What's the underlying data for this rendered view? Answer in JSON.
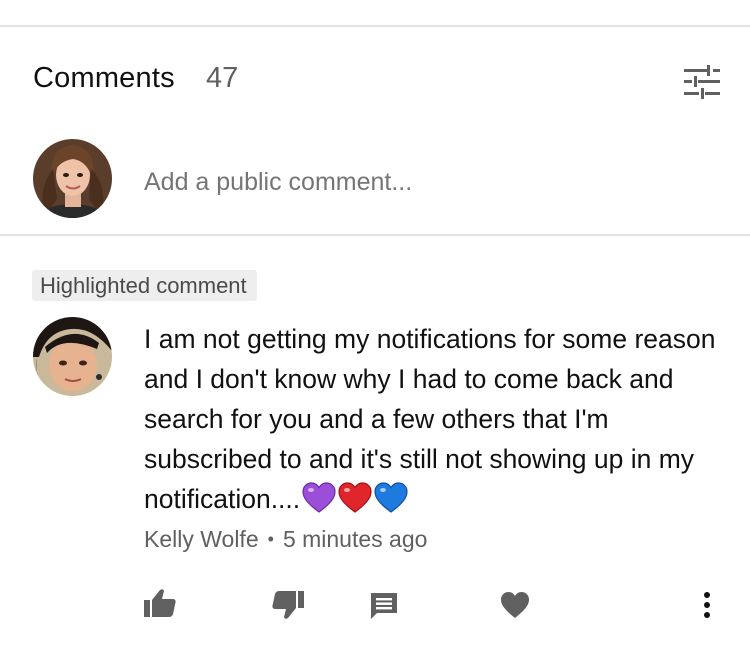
{
  "header": {
    "title": "Comments",
    "count": "47",
    "sort_icon": "sort-filter-icon"
  },
  "composer": {
    "avatar_icon": "user-avatar",
    "placeholder": "Add a public comment..."
  },
  "comment": {
    "badge": "Highlighted comment",
    "avatar_icon": "commenter-avatar",
    "text": "I am not getting my notifications for some reason and I don't know why I had to come back and search for you and a few others that I'm subscribed to and it's still not showing up in my notification....",
    "emoji": [
      "purple-heart",
      "red-heart",
      "blue-heart"
    ],
    "author": "Kelly Wolfe",
    "separator": "•",
    "time": "5 minutes ago"
  },
  "actions": {
    "like_icon": "thumbs-up-icon",
    "dislike_icon": "thumbs-down-icon",
    "reply_icon": "reply-comment-icon",
    "heart_icon": "heart-icon",
    "more_icon": "more-vertical-icon"
  },
  "colors": {
    "text_primary": "#111111",
    "text_secondary": "#606060",
    "icon_gray": "#606060",
    "divider": "#e3e3e3",
    "badge_bg": "#eeeeee",
    "heart_purple": "#9b4fd9",
    "heart_red": "#e0262b",
    "heart_blue": "#1f7ae0"
  }
}
